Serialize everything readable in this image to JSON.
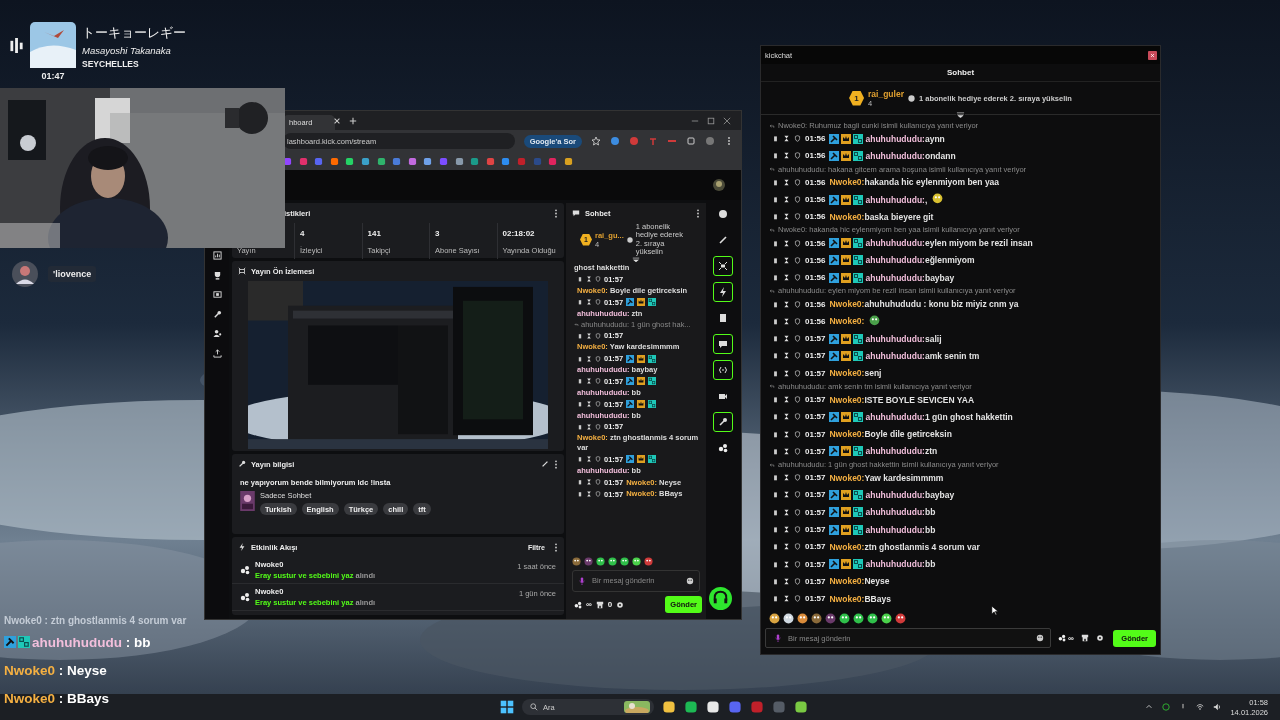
{
  "music": {
    "title": "トーキョーレギー",
    "artist": "Masayoshi Takanaka",
    "album": "SEYCHELLES",
    "time": "01:47"
  },
  "viewer": {
    "name": "'liovence"
  },
  "browser": {
    "tab": "hboard",
    "url": "lashboard.kick.com/stream",
    "ask": "Google'a Sor",
    "stats": {
      "title": "istikleri",
      "items": [
        {
          "label": "Yayın"
        },
        {
          "value": "4",
          "label": "İzleyici"
        },
        {
          "value": "141",
          "label": "Takipçi"
        },
        {
          "value": "3",
          "label": "Abone Sayısı"
        },
        {
          "value": "02:18:02",
          "label": "Yayında Olduğu"
        }
      ]
    },
    "preview": {
      "title": "Yayın Ön İzlemesi"
    },
    "info": {
      "title": "Yayın bilgisi",
      "stream_title": "ne yapıyorum bende bilmiyorum ldc !insta",
      "category": "Sadece Sohbet",
      "tags": [
        "Turkish",
        "English",
        "Türkçe",
        "chill",
        "tft"
      ]
    },
    "activity": {
      "title": "Etkinlik Akışı",
      "filter": "Filtre",
      "events": [
        {
          "user": "Nwoke0",
          "reward": "Eray sustur ve sebebini yaz",
          "action": "alındı",
          "time": "1 saat önce"
        },
        {
          "user": "Nwoke0",
          "reward": "Eray sustur ve sebebini yaz",
          "action": "alındı",
          "time": "1 gün önce"
        }
      ]
    },
    "chat": {
      "title": "Sohbet",
      "top": {
        "rank": "1",
        "name": "rai_gu...",
        "count": "4",
        "promo": "1 abonelik hediye ederek 2. sıraya yükselin"
      },
      "messages": [
        {
          "kind": "fragment",
          "text": "ghost hakkettin"
        },
        {
          "kind": "message",
          "time": "01:57",
          "user": "Nwoke0:",
          "color": "#f5b042",
          "badges": false,
          "text": "Boyle dile getirceksin"
        },
        {
          "kind": "message",
          "time": "01:57",
          "user": "ahuhuhududu:",
          "color": "#f3bfdc",
          "badges": true,
          "text": "ztn"
        },
        {
          "kind": "reply",
          "text": "ahuhuhududu: 1 gün ghost hak..."
        },
        {
          "kind": "message",
          "time": "01:57",
          "user": "Nwoke0:",
          "color": "#f5b042",
          "badges": false,
          "text": "Yaw kardesimmmm"
        },
        {
          "kind": "message",
          "time": "01:57",
          "user": "ahuhuhududu:",
          "color": "#f3bfdc",
          "badges": true,
          "text": "baybay"
        },
        {
          "kind": "message",
          "time": "01:57",
          "user": "ahuhuhududu:",
          "color": "#f3bfdc",
          "badges": true,
          "text": "bb"
        },
        {
          "kind": "message",
          "time": "01:57",
          "user": "ahuhuhududu:",
          "color": "#f3bfdc",
          "badges": true,
          "text": "bb"
        },
        {
          "kind": "message",
          "time": "01:57",
          "user": "Nwoke0:",
          "color": "#f5b042",
          "badges": false,
          "text": "ztn ghostlanmis 4 sorum var"
        },
        {
          "kind": "message",
          "time": "01:57",
          "user": "ahuhuhududu:",
          "color": "#f3bfdc",
          "badges": true,
          "text": "bb"
        },
        {
          "kind": "message",
          "time": "01:57",
          "user": "Nwoke0:",
          "color": "#f5b042",
          "badges": false,
          "text": "Neyse"
        },
        {
          "kind": "message",
          "time": "01:57",
          "user": "Nwoke0:",
          "color": "#f5b042",
          "badges": false,
          "text": "BBays"
        }
      ],
      "placeholder": "Bir mesaj gönderin",
      "points": "∞",
      "cart": "0",
      "send": "Gönder"
    },
    "tools": [
      {
        "kind": "info",
        "on": false
      },
      {
        "kind": "pencil",
        "on": false
      },
      {
        "kind": "screen",
        "on": true
      },
      {
        "kind": "bolt",
        "on": true
      },
      {
        "kind": "note",
        "on": false
      },
      {
        "kind": "chat",
        "on": true
      },
      {
        "kind": "broadcast",
        "on": true
      },
      {
        "kind": "camera",
        "on": false
      },
      {
        "kind": "wrench",
        "on": true
      },
      {
        "kind": "nodes",
        "on": false
      }
    ]
  },
  "kickchat": {
    "window_title": "kickchat",
    "title": "Sohbet",
    "top": {
      "rank": "1",
      "name": "rai_guler",
      "count": "4",
      "promo": "1 abonelik hediye ederek 2. sıraya yükselin"
    },
    "messages": [
      {
        "kind": "reply",
        "text": "Nwoke0: Ruhumuz bagli cunki isimli kullanıcıya yanıt veriyor"
      },
      {
        "kind": "message",
        "time": "01:56",
        "user": "ahuhuhududu:",
        "color": "#f3bfdc",
        "badges": true,
        "text": "aynn"
      },
      {
        "kind": "message",
        "time": "01:56",
        "user": "ahuhuhududu:",
        "color": "#f3bfdc",
        "badges": true,
        "text": "ondann"
      },
      {
        "kind": "reply",
        "text": "ahuhuhududu: hakana gitcem arama boşuna isimli kullanıcıya yanıt veriyor"
      },
      {
        "kind": "message",
        "time": "01:56",
        "user": "Nwoke0:",
        "color": "#f5b042",
        "badges": false,
        "text": "hakanda hic eylenmiyom ben yaa"
      },
      {
        "kind": "emote",
        "time": "01:56",
        "user": "ahuhuhududu:",
        "color": "#f3bfdc",
        "badges": true,
        "text": ","
      },
      {
        "kind": "message",
        "time": "01:56",
        "user": "Nwoke0:",
        "color": "#f5b042",
        "badges": false,
        "text": "baska bieyere git"
      },
      {
        "kind": "reply",
        "text": "Nwoke0: hakanda hic eylenmiyom ben yaa isimli kullanıcıya yanıt veriyor"
      },
      {
        "kind": "message",
        "time": "01:56",
        "user": "ahuhuhududu:",
        "color": "#f3bfdc",
        "badges": true,
        "text": "eylen miyom be rezil insan"
      },
      {
        "kind": "message",
        "time": "01:56",
        "user": "ahuhuhududu:",
        "color": "#f3bfdc",
        "badges": true,
        "text": "eğlenmiyom"
      },
      {
        "kind": "message",
        "time": "01:56",
        "user": "ahuhuhududu:",
        "color": "#f3bfdc",
        "badges": true,
        "text": "baybay"
      },
      {
        "kind": "reply",
        "text": "ahuhuhududu: eylen miyom be rezil insan isimli kullanıcıya yanıt veriyor"
      },
      {
        "kind": "message",
        "time": "01:56",
        "user": "Nwoke0:",
        "color": "#f5b042",
        "badges": false,
        "text": "ahuhuhududu : konu biz miyiz cnm ya"
      },
      {
        "kind": "emote",
        "time": "01:56",
        "user": "Nwoke0:",
        "color": "#f5b042",
        "badges": false
      },
      {
        "kind": "message",
        "time": "01:57",
        "user": "ahuhuhududu:",
        "color": "#f3bfdc",
        "badges": true,
        "text": "salij"
      },
      {
        "kind": "message",
        "time": "01:57",
        "user": "ahuhuhududu:",
        "color": "#f3bfdc",
        "badges": true,
        "text": "amk senin tm"
      },
      {
        "kind": "message",
        "time": "01:57",
        "user": "Nwoke0:",
        "color": "#f5b042",
        "badges": false,
        "text": "senj"
      },
      {
        "kind": "reply",
        "text": "ahuhuhududu: amk senin tm isimli kullanıcıya yanıt veriyor"
      },
      {
        "kind": "message",
        "time": "01:57",
        "user": "Nwoke0:",
        "color": "#f5b042",
        "badges": false,
        "text": "ISTE BOYLE SEVICEN YAA"
      },
      {
        "kind": "message",
        "time": "01:57",
        "user": "ahuhuhududu:",
        "color": "#f3bfdc",
        "badges": true,
        "text": "1 gün ghost hakkettin"
      },
      {
        "kind": "message",
        "time": "01:57",
        "user": "Nwoke0:",
        "color": "#f5b042",
        "badges": false,
        "text": "Boyle dile getirceksin"
      },
      {
        "kind": "message",
        "time": "01:57",
        "user": "ahuhuhududu:",
        "color": "#f3bfdc",
        "badges": true,
        "text": "ztn"
      },
      {
        "kind": "reply",
        "text": "ahuhuhududu: 1 gün ghost hakkettin isimli kullanıcıya yanıt veriyor"
      },
      {
        "kind": "message",
        "time": "01:57",
        "user": "Nwoke0:",
        "color": "#f5b042",
        "badges": false,
        "text": "Yaw kardesimmmm"
      },
      {
        "kind": "message",
        "time": "01:57",
        "user": "ahuhuhududu:",
        "color": "#f3bfdc",
        "badges": true,
        "text": "baybay"
      },
      {
        "kind": "message",
        "time": "01:57",
        "user": "ahuhuhududu:",
        "color": "#f3bfdc",
        "badges": true,
        "text": "bb"
      },
      {
        "kind": "message",
        "time": "01:57",
        "user": "ahuhuhududu:",
        "color": "#f3bfdc",
        "badges": true,
        "text": "bb"
      },
      {
        "kind": "message",
        "time": "01:57",
        "user": "Nwoke0:",
        "color": "#f5b042",
        "badges": false,
        "text": "ztn ghostlanmis 4 sorum var"
      },
      {
        "kind": "message",
        "time": "01:57",
        "user": "ahuhuhududu:",
        "color": "#f3bfdc",
        "badges": true,
        "text": "bb"
      },
      {
        "kind": "message",
        "time": "01:57",
        "user": "Nwoke0:",
        "color": "#f5b042",
        "badges": false,
        "text": "Neyse"
      },
      {
        "kind": "message",
        "time": "01:57",
        "user": "Nwoke0:",
        "color": "#f5b042",
        "badges": false,
        "text": "BBays"
      }
    ],
    "placeholder": "Bir mesaj gönderin",
    "points": "∞",
    "send": "Gönder"
  },
  "overlay_chat": [
    {
      "user": "Nwoke0",
      "badges": false,
      "fading": true,
      "text": ": ztn ghostlanmis 4 sorum var"
    },
    {
      "user": "ahuhuhududu",
      "color": "#f3bfdc",
      "badges": true,
      "fading": false,
      "text": ": bb"
    },
    {
      "user": "Nwoke0",
      "color": "#f5b042",
      "badges": false,
      "fading": false,
      "text": ": Neyse"
    },
    {
      "user": "Nwoke0",
      "color": "#f5b042",
      "badges": false,
      "fading": false,
      "text": ": BBays"
    }
  ],
  "taskbar": {
    "search": "Ara",
    "time": "01:58",
    "date": "14.01.2026"
  }
}
